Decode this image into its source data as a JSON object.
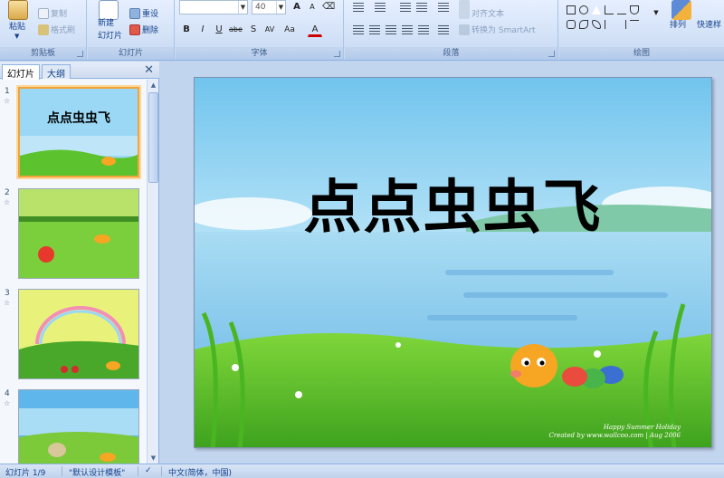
{
  "ribbon": {
    "clipboard": {
      "label": "剪贴板",
      "paste": "粘贴",
      "copy": "复制",
      "format_painter": "格式刷"
    },
    "slides": {
      "label": "幻灯片",
      "new_slide_line1": "新建",
      "new_slide_line2": "幻灯片",
      "reset": "重设",
      "delete": "删除"
    },
    "font": {
      "label": "字体",
      "font_name": "",
      "font_size": "40",
      "bold": "B",
      "italic": "I",
      "underline": "U",
      "strike": "abe",
      "shadow": "S",
      "spacing": "AV",
      "case": "Aa",
      "color": "A"
    },
    "paragraph": {
      "label": "段落",
      "align_text": "对齐文本",
      "convert_smartart": "转换为 SmartArt"
    },
    "drawing": {
      "label": "绘图",
      "arrange": "排列",
      "quick_styles": "快速样"
    }
  },
  "panel": {
    "tab_slides": "幻灯片",
    "tab_outline": "大纲",
    "close": "✕",
    "thumbnails": [
      {
        "number": "1",
        "title": "点点虫虫飞",
        "selected": true
      },
      {
        "number": "2",
        "selected": false
      },
      {
        "number": "3",
        "selected": false
      },
      {
        "number": "4",
        "selected": false
      }
    ]
  },
  "slide": {
    "title": "点点虫虫飞",
    "footer_line1": "Happy Summer Holiday",
    "footer_line2": "Created by www.wallcoo.com | Aug 2006"
  },
  "status": {
    "slide_counter": "幻灯片 1/9",
    "theme": "\"默认设计模板\"",
    "language": "中文(简体，中国)"
  },
  "colors": {
    "ribbon_bg": "#d5e3f8",
    "selection": "#f2a33a",
    "sky": "#8fd0f2",
    "grass": "#5cc22d"
  }
}
